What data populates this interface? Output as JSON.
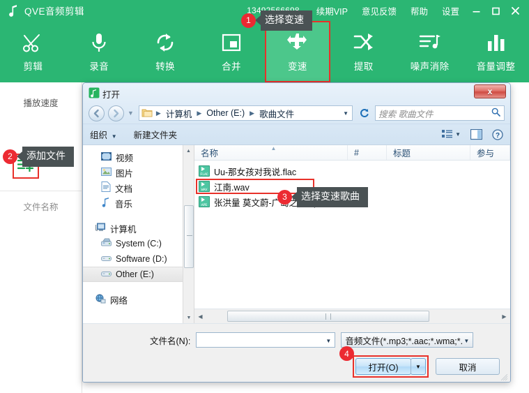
{
  "app": {
    "title": "QVE音频剪辑",
    "phone": "13492566698",
    "menu": [
      "续期VIP",
      "意见反馈",
      "帮助",
      "设置"
    ],
    "window_controls": {
      "minimize": "minimize-icon",
      "maximize": "maximize-icon",
      "close": "close-icon"
    },
    "toolbar": [
      {
        "label": "剪辑",
        "icon": "scissors-icon"
      },
      {
        "label": "录音",
        "icon": "microphone-icon"
      },
      {
        "label": "转换",
        "icon": "convert-icon"
      },
      {
        "label": "合并",
        "icon": "merge-icon"
      },
      {
        "label": "变速",
        "icon": "speed-icon"
      },
      {
        "label": "提取",
        "icon": "extract-icon"
      },
      {
        "label": "噪声消除",
        "icon": "noise-reduce-icon"
      },
      {
        "label": "音量调整",
        "icon": "volume-icon"
      }
    ],
    "left_panel": {
      "title": "播放速度",
      "add_file_icon": "add-file-icon",
      "file_name_header": "文件名称"
    },
    "accent_color": "#2bb673",
    "accent_active": "#4cc78b",
    "mark_color": "#e8312a"
  },
  "tooltips": [
    {
      "badge": "1",
      "text": "选择变速"
    },
    {
      "badge": "2",
      "text": "添加文件"
    },
    {
      "badge": "3",
      "text": "选择变速歌曲"
    },
    {
      "badge": "4",
      "text": ""
    }
  ],
  "dialog": {
    "title": "打开",
    "close_label": "x",
    "breadcrumb": [
      "计算机",
      "Other (E:)",
      "歌曲文件"
    ],
    "search_placeholder": "搜索 歌曲文件",
    "toolbar": {
      "organize": "组织",
      "new_folder": "新建文件夹"
    },
    "nav_items": [
      {
        "label": "视频",
        "icon": "video-icon",
        "level": "child",
        "selected": false
      },
      {
        "label": "图片",
        "icon": "picture-icon",
        "level": "child",
        "selected": false
      },
      {
        "label": "文档",
        "icon": "document-icon",
        "level": "child",
        "selected": false
      },
      {
        "label": "音乐",
        "icon": "music-icon",
        "level": "child",
        "selected": false
      },
      {
        "label": "计算机",
        "icon": "computer-icon",
        "level": "root",
        "selected": false
      },
      {
        "label": "System (C:)",
        "icon": "system-drive-icon",
        "level": "child",
        "selected": false
      },
      {
        "label": "Software (D:)",
        "icon": "drive-icon",
        "level": "child",
        "selected": false
      },
      {
        "label": "Other (E:)",
        "icon": "drive-icon",
        "level": "child",
        "selected": true
      },
      {
        "label": "网络",
        "icon": "network-icon",
        "level": "root",
        "selected": false
      }
    ],
    "columns": [
      "名称",
      "#",
      "标题",
      "参与"
    ],
    "files": [
      {
        "name": "Uu-那女孩对我说.flac",
        "ext": "FLAC",
        "selected": false
      },
      {
        "name": "江南.wav",
        "ext": "WAV",
        "selected": true
      },
      {
        "name": "张洪量 莫文蔚-广岛之恋.ape",
        "ext": "APE",
        "selected": false
      }
    ],
    "footer": {
      "filename_label": "文件名(N):",
      "filename_value": "",
      "filetype": "音频文件(*.mp3;*.aac;*.wma;*.",
      "open_button": "打开(O)",
      "cancel_button": "取消"
    }
  }
}
